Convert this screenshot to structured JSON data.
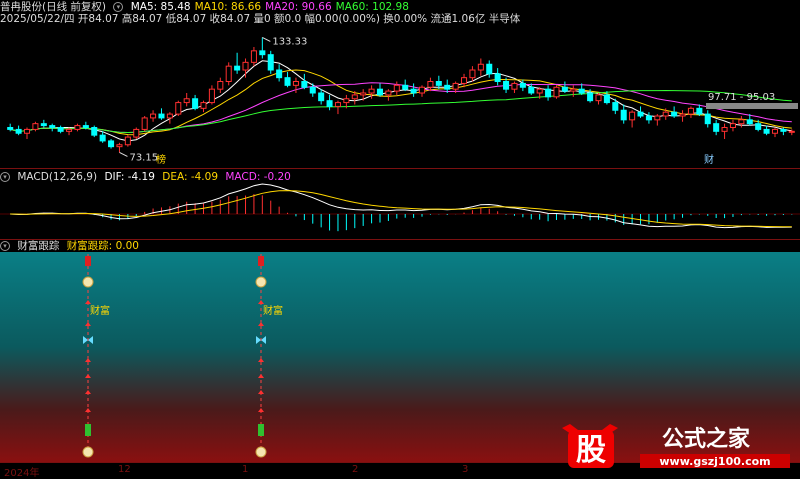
{
  "header": {
    "title": "普冉股份(日线 前复权)",
    "ma": [
      {
        "label": "MA5: 85.48",
        "color": "#ffffff"
      },
      {
        "label": "MA10: 86.66",
        "color": "#ffd700"
      },
      {
        "label": "MA20: 90.66",
        "color": "#ff44ff"
      },
      {
        "label": "MA60: 102.98",
        "color": "#33ff33"
      }
    ],
    "info": "2025/05/22/四 开84.07 高84.07 低84.07 收84.07 量0 额0.0 幅0.00(0.00%) 换0.00% 流通1.06亿 半导体"
  },
  "macd_header": {
    "name": "MACD(12,26,9)",
    "dif": "DIF: -4.19",
    "dea": "DEA: -4.09",
    "macd": "MACD: -0.20"
  },
  "wealth_header": {
    "name": "财富跟踪",
    "value": "财富跟踪: 0.00"
  },
  "annotations": {
    "high": "133.33",
    "low": "73.15",
    "range": "97.71 - 95.03",
    "tag1": "榜",
    "tag2": "财",
    "wealth_label": "财富"
  },
  "x_axis": [
    "2024年",
    "12",
    "1",
    "2",
    "3"
  ],
  "logo": {
    "char": "股",
    "name": "公式之家",
    "url": "www.gszj100.com"
  },
  "chart_data": {
    "type": "candlestick",
    "ylim": [
      68,
      140
    ],
    "candles": [
      [
        86,
        88,
        84,
        85
      ],
      [
        85,
        87,
        82,
        83
      ],
      [
        83,
        86,
        80,
        85
      ],
      [
        85,
        89,
        84,
        88
      ],
      [
        88,
        90,
        86,
        87
      ],
      [
        87,
        88,
        84,
        86
      ],
      [
        86,
        87,
        83,
        84
      ],
      [
        84,
        86,
        82,
        85
      ],
      [
        85,
        88,
        84,
        87
      ],
      [
        87,
        89,
        85,
        86
      ],
      [
        86,
        87,
        81,
        82
      ],
      [
        82,
        84,
        78,
        79
      ],
      [
        79,
        80,
        75,
        76
      ],
      [
        76,
        78,
        73,
        77
      ],
      [
        77,
        82,
        76,
        81
      ],
      [
        81,
        86,
        80,
        85
      ],
      [
        85,
        92,
        84,
        91
      ],
      [
        91,
        95,
        89,
        93
      ],
      [
        93,
        96,
        90,
        91
      ],
      [
        91,
        94,
        88,
        93
      ],
      [
        93,
        100,
        92,
        99
      ],
      [
        99,
        104,
        97,
        101
      ],
      [
        101,
        103,
        95,
        96
      ],
      [
        96,
        100,
        94,
        99
      ],
      [
        99,
        108,
        98,
        106
      ],
      [
        106,
        112,
        104,
        110
      ],
      [
        110,
        120,
        108,
        118
      ],
      [
        118,
        125,
        114,
        116
      ],
      [
        116,
        122,
        112,
        120
      ],
      [
        120,
        128,
        118,
        126
      ],
      [
        126,
        133,
        122,
        124
      ],
      [
        124,
        126,
        114,
        116
      ],
      [
        116,
        119,
        110,
        112
      ],
      [
        112,
        115,
        107,
        108
      ],
      [
        108,
        112,
        104,
        110
      ],
      [
        110,
        114,
        106,
        107
      ],
      [
        107,
        109,
        102,
        104
      ],
      [
        104,
        106,
        98,
        100
      ],
      [
        100,
        103,
        95,
        97
      ],
      [
        97,
        100,
        93,
        99
      ],
      [
        99,
        103,
        96,
        101
      ],
      [
        101,
        105,
        98,
        103
      ],
      [
        103,
        106,
        100,
        104
      ],
      [
        104,
        108,
        101,
        106
      ],
      [
        106,
        109,
        102,
        103
      ],
      [
        103,
        106,
        100,
        105
      ],
      [
        105,
        110,
        103,
        108
      ],
      [
        108,
        111,
        105,
        106
      ],
      [
        106,
        109,
        102,
        104
      ],
      [
        104,
        108,
        102,
        107
      ],
      [
        107,
        112,
        105,
        110
      ],
      [
        110,
        113,
        106,
        108
      ],
      [
        108,
        111,
        104,
        106
      ],
      [
        106,
        110,
        104,
        109
      ],
      [
        109,
        114,
        107,
        112
      ],
      [
        112,
        118,
        110,
        116
      ],
      [
        116,
        122,
        113,
        119
      ],
      [
        119,
        121,
        112,
        114
      ],
      [
        114,
        117,
        108,
        110
      ],
      [
        110,
        112,
        104,
        106
      ],
      [
        106,
        110,
        104,
        109
      ],
      [
        109,
        111,
        105,
        107
      ],
      [
        107,
        109,
        103,
        104
      ],
      [
        104,
        107,
        101,
        106
      ],
      [
        106,
        108,
        100,
        102
      ],
      [
        102,
        108,
        101,
        107
      ],
      [
        107,
        110,
        104,
        105
      ],
      [
        105,
        108,
        102,
        106
      ],
      [
        106,
        109,
        103,
        104
      ],
      [
        104,
        106,
        99,
        100
      ],
      [
        100,
        104,
        98,
        103
      ],
      [
        103,
        105,
        98,
        99
      ],
      [
        99,
        101,
        93,
        95
      ],
      [
        95,
        98,
        88,
        90
      ],
      [
        90,
        95,
        86,
        94
      ],
      [
        94,
        97,
        91,
        92
      ],
      [
        92,
        94,
        88,
        90
      ],
      [
        90,
        93,
        87,
        92
      ],
      [
        92,
        96,
        90,
        94
      ],
      [
        94,
        97,
        91,
        92
      ],
      [
        92,
        95,
        89,
        93
      ],
      [
        93,
        97,
        91,
        96
      ],
      [
        96,
        98,
        92,
        93
      ],
      [
        93,
        95,
        86,
        88
      ],
      [
        88,
        90,
        82,
        84
      ],
      [
        84,
        88,
        80,
        86
      ],
      [
        86,
        90,
        84,
        88
      ],
      [
        88,
        92,
        86,
        90
      ],
      [
        90,
        93,
        87,
        88
      ],
      [
        88,
        90,
        84,
        85
      ],
      [
        85,
        87,
        82,
        83
      ],
      [
        83,
        86,
        81,
        85
      ],
      [
        85,
        86,
        82,
        84
      ],
      [
        84,
        85,
        82,
        84
      ]
    ]
  }
}
